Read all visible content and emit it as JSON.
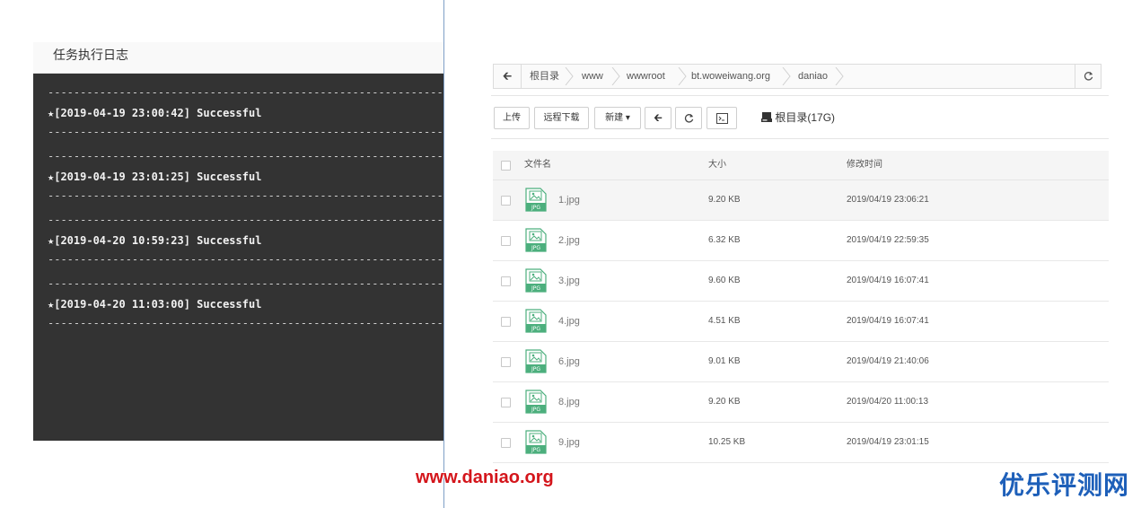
{
  "log": {
    "title": "任务执行日志",
    "dash": "--------------------------------------------------------------------",
    "entries": [
      {
        "text": "★[2019-04-19 23:00:42] Successful"
      },
      {
        "text": "★[2019-04-19 23:01:25] Successful"
      },
      {
        "text": "★[2019-04-20 10:59:23] Successful"
      },
      {
        "text": "★[2019-04-20 11:03:00] Successful"
      }
    ]
  },
  "breadcrumb": {
    "back_icon": "arrow-left-icon",
    "items": [
      "根目录",
      "www",
      "wwwroot",
      "bt.woweiwang.org",
      "daniao"
    ],
    "refresh_icon": "refresh-icon"
  },
  "toolbar": {
    "upload_label": "上传",
    "remote_download_label": "远程下载",
    "new_label": "新建",
    "new_caret": "▾",
    "back_icon": "arrow-left-icon",
    "refresh_icon": "refresh-icon",
    "terminal_icon": "terminal-icon",
    "disk_label": "根目录(17G)",
    "disk_icon": "disk-icon"
  },
  "table": {
    "headers": {
      "name": "文件名",
      "size": "大小",
      "modified": "修改时间"
    },
    "rows": [
      {
        "name": "1.jpg",
        "size": "9.20 KB",
        "modified": "2019/04/19 23:06:21"
      },
      {
        "name": "2.jpg",
        "size": "6.32 KB",
        "modified": "2019/04/19 22:59:35"
      },
      {
        "name": "3.jpg",
        "size": "9.60 KB",
        "modified": "2019/04/19 16:07:41"
      },
      {
        "name": "4.jpg",
        "size": "4.51 KB",
        "modified": "2019/04/19 16:07:41"
      },
      {
        "name": "6.jpg",
        "size": "9.01 KB",
        "modified": "2019/04/19 21:40:06"
      },
      {
        "name": "8.jpg",
        "size": "9.20 KB",
        "modified": "2019/04/20 11:00:13"
      },
      {
        "name": "9.jpg",
        "size": "10.25 KB",
        "modified": "2019/04/19 23:01:15"
      }
    ],
    "file_icon": "jpg-file-icon",
    "file_icon_tag": "JPG"
  },
  "watermarks": {
    "left": "www.daniao.org",
    "right": "优乐评测网"
  },
  "colors": {
    "log_bg": "#333333",
    "watermark_left": "#d4151b",
    "watermark_right": "#1d5fb9",
    "file_icon_green": "#4caf7d"
  }
}
